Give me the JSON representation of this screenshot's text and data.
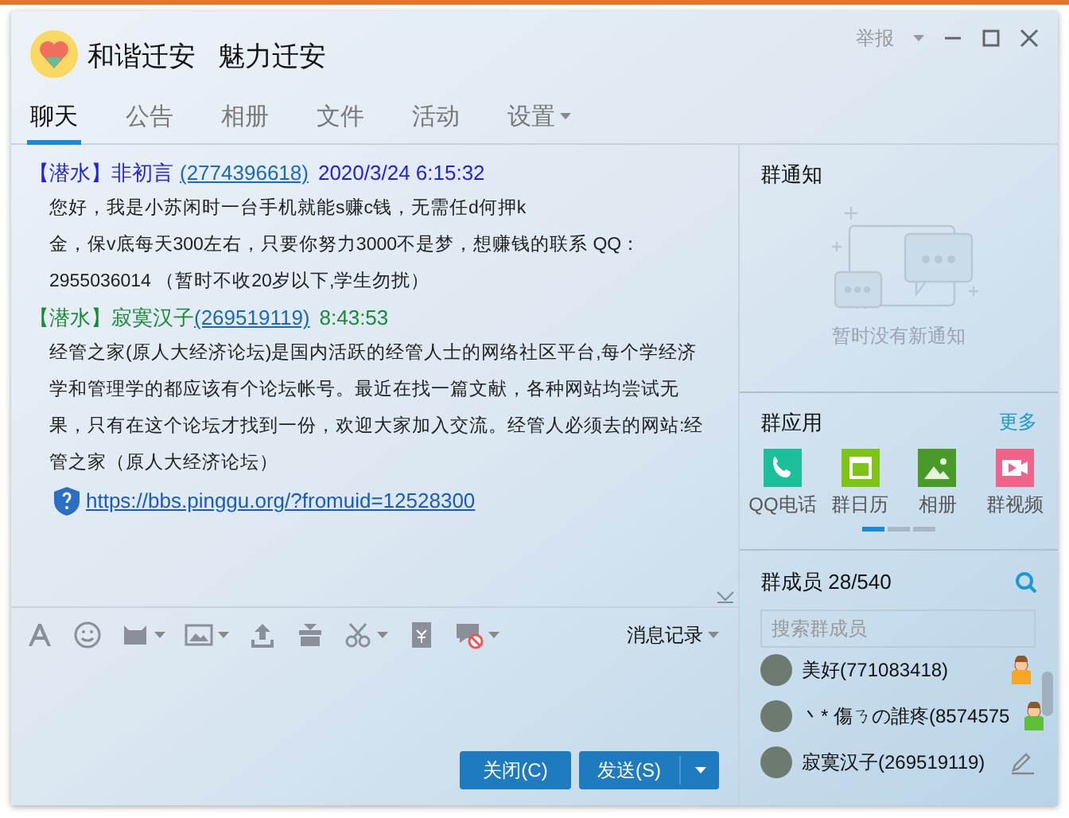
{
  "window": {
    "title": "和谐迁安",
    "subtitle": "魅力迁安",
    "report": "举报"
  },
  "tabs": [
    {
      "label": "聊天",
      "selected": true,
      "dropdown": false
    },
    {
      "label": "公告",
      "selected": false,
      "dropdown": false
    },
    {
      "label": "相册",
      "selected": false,
      "dropdown": false
    },
    {
      "label": "文件",
      "selected": false,
      "dropdown": false
    },
    {
      "label": "活动",
      "selected": false,
      "dropdown": false
    },
    {
      "label": "设置",
      "selected": false,
      "dropdown": true
    }
  ],
  "messages": [
    {
      "role": "【潜水】",
      "name": "非初言",
      "qq": "(2774396618)",
      "time": "2020/3/24 6:15:32",
      "color": "#2222dd",
      "lines": [
        "您好，我是小苏闲时一台手机就能s赚c钱，无需任d何押k",
        "金，保v底每天300左右，只要你努力3000不是梦，想赚钱的联系 QQ：",
        "2955036014 （暂时不收20岁以下,学生勿扰）"
      ]
    },
    {
      "role": "【潜水】",
      "name": "寂寞汉子",
      "qq": "(269519119)",
      "time": "8:43:53",
      "color": "#1a8a3a",
      "lines": [
        "经管之家(原人大经济论坛)是国内活跃的经管人士的网络社区平台,每个学经济",
        "学和管理学的都应该有个论坛帐号。最近在找一篇文献，各种网站均尝试无",
        "果，只有在这个论坛才找到一份，欢迎大家加入交流。经管人必须去的网站:经",
        "管之家（原人大经济论坛）"
      ],
      "link": "https://bbs.pinggu.org/?fromuid=12528300"
    }
  ],
  "toolbar": {
    "history": "消息记录"
  },
  "buttons": {
    "close": "关闭(C)",
    "send": "发送(S)"
  },
  "notice": {
    "title": "群通知",
    "empty": "暂时没有新通知"
  },
  "apps": {
    "title": "群应用",
    "more": "更多",
    "items": [
      {
        "label": "QQ电话",
        "kind": "phone"
      },
      {
        "label": "群日历",
        "kind": "calendar"
      },
      {
        "label": "相册",
        "kind": "album"
      },
      {
        "label": "群视频",
        "kind": "video"
      }
    ],
    "pager": [
      {
        "selected": true
      },
      {
        "selected": false
      },
      {
        "selected": false
      }
    ]
  },
  "members": {
    "title": "群成员 28/540",
    "placeholder": "搜索群成员",
    "items": [
      {
        "name": "美好(771083418)",
        "kind": "owner"
      },
      {
        "name": "丶* 傷ㄋの誰疼(8574575",
        "kind": "admin"
      },
      {
        "name": "寂寞汉子(269519119)",
        "kind": "editor"
      }
    ]
  }
}
